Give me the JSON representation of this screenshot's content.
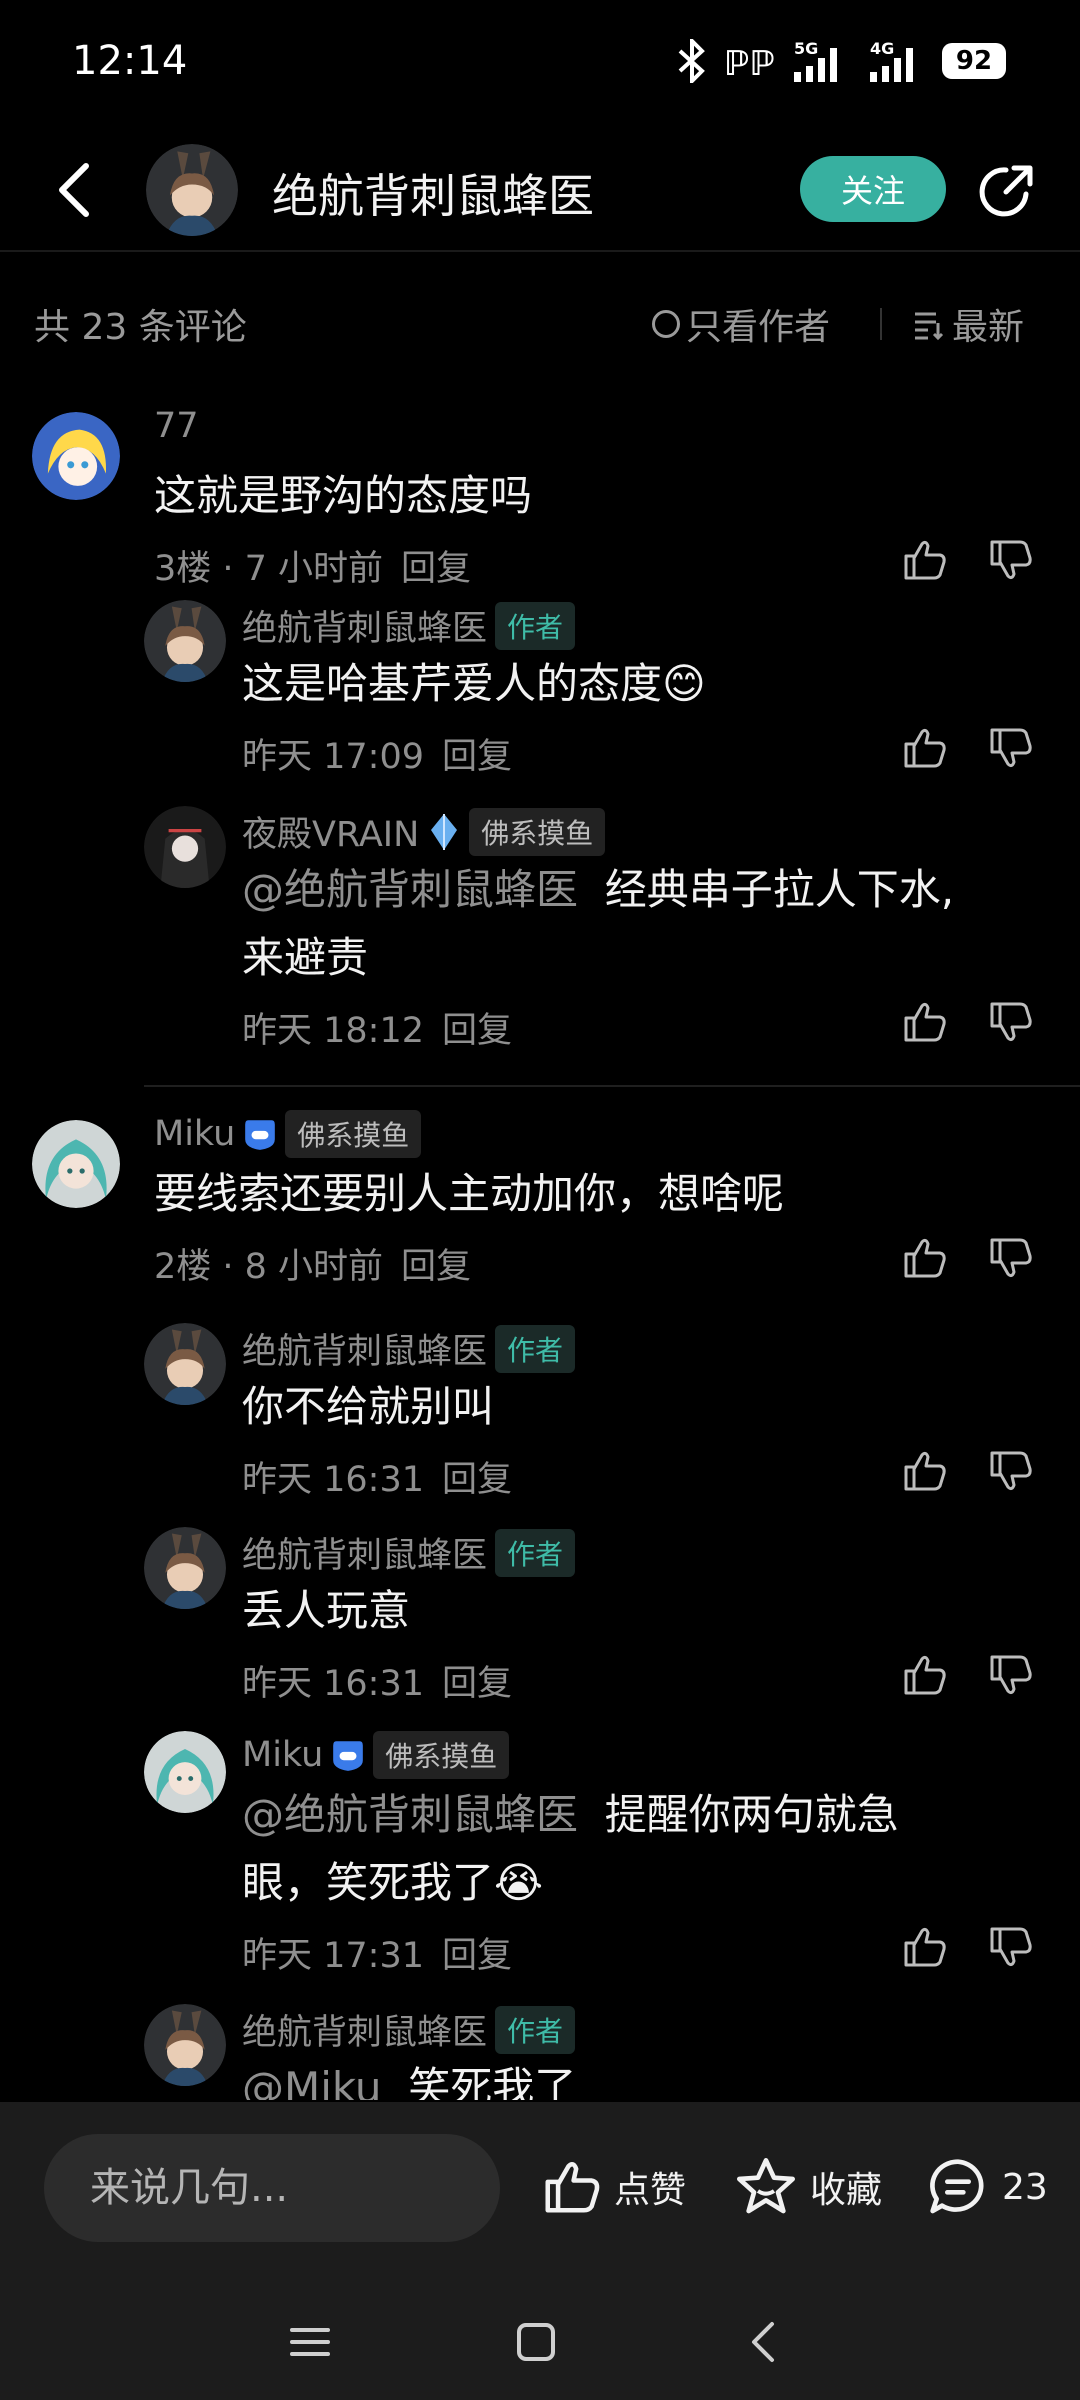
{
  "status_bar": {
    "time": "12:14",
    "battery": "92",
    "net1": "5G",
    "net2": "4G"
  },
  "header": {
    "title": "绝航背刺鼠蜂医",
    "follow_label": "关注"
  },
  "filter": {
    "count_text": "共 23 条评论",
    "author_only_label": "只看作者",
    "sort_label": "最新"
  },
  "comments": [
    {
      "user": "77",
      "text": "这就是野沟的态度吗",
      "floor": "3楼 · 7 小时前",
      "reply_label": "回复",
      "replies": [
        {
          "user": "绝航背刺鼠蜂医",
          "tag": "作者",
          "text": "这是哈基芹爱人的态度😊",
          "time": "昨天 17:09",
          "reply_label": "回复"
        },
        {
          "user": "夜殿VRAIN",
          "tag": "佛系摸鱼",
          "mention": "@绝航背刺鼠蜂医",
          "line1": "经典串子拉人下水,",
          "line2": "来避责",
          "time": "昨天 18:12",
          "reply_label": "回复"
        }
      ]
    },
    {
      "user": "Miku",
      "tag": "佛系摸鱼",
      "text": "要线索还要别人主动加你，想啥呢",
      "floor": "2楼 · 8 小时前",
      "reply_label": "回复",
      "replies": [
        {
          "user": "绝航背刺鼠蜂医",
          "tag": "作者",
          "text": "你不给就别叫",
          "time": "昨天 16:31",
          "reply_label": "回复"
        },
        {
          "user": "绝航背刺鼠蜂医",
          "tag": "作者",
          "text": "丢人玩意",
          "time": "昨天 16:31",
          "reply_label": "回复"
        },
        {
          "user": "Miku",
          "tag": "佛系摸鱼",
          "mention": "@绝航背刺鼠蜂医",
          "line1": "提醒你两句就急",
          "line2": "眼，笑死我了😭",
          "time": "昨天 17:31",
          "reply_label": "回复"
        },
        {
          "user": "绝航背刺鼠蜂医",
          "tag": "作者",
          "mention": "@Miku",
          "text": "笑死我了"
        }
      ]
    }
  ],
  "bottom_bar": {
    "input_placeholder": "来说几句...",
    "like_label": "点赞",
    "fav_label": "收藏",
    "comment_count": "23"
  },
  "colors": {
    "accent": "#37b0a0",
    "background": "#000000",
    "secondary_text": "#8f8f8f"
  }
}
